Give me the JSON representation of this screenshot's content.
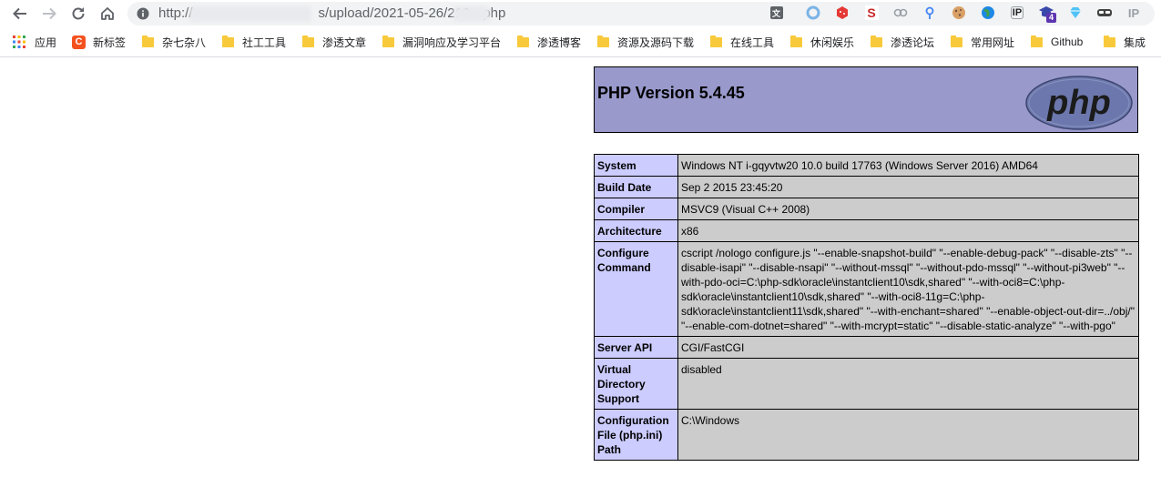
{
  "browser": {
    "url": {
      "scheme": "http://",
      "path": "s/upload/2021-05-26/210",
      "extension": "php"
    },
    "extension_icons": [
      "translate-icon",
      "circle-extension-icon",
      "red-cube-extension-icon",
      "s-badge-extension-icon",
      "link-extension-icon",
      "pin-extension-icon",
      "cookie-extension-icon",
      "globe-extension-icon",
      "ip-extension-icon",
      "graduation-cap-extension-icon",
      "diamond-extension-icon",
      "mask-extension-icon",
      "ip-text-extension-icon"
    ],
    "extension_badge": "4",
    "ip_label_1": "IP",
    "ip_label_2": "IP",
    "s_badge": "S",
    "bookmarks": [
      {
        "label": "应用",
        "kind": "apps"
      },
      {
        "label": "新标签",
        "kind": "c"
      },
      {
        "label": "杂七杂八",
        "kind": "folder"
      },
      {
        "label": "社工工具",
        "kind": "folder"
      },
      {
        "label": "渗透文章",
        "kind": "folder"
      },
      {
        "label": "漏洞响应及学习平台",
        "kind": "folder"
      },
      {
        "label": "渗透博客",
        "kind": "folder"
      },
      {
        "label": "资源及源码下载",
        "kind": "folder"
      },
      {
        "label": "在线工具",
        "kind": "folder"
      },
      {
        "label": "休闲娱乐",
        "kind": "folder"
      },
      {
        "label": "渗透论坛",
        "kind": "folder"
      },
      {
        "label": "常用网址",
        "kind": "folder"
      },
      {
        "label": "Github",
        "kind": "folder"
      },
      {
        "label": "集成",
        "kind": "folder"
      }
    ],
    "c_icon_letter": "C"
  },
  "phpinfo": {
    "title": "PHP Version 5.4.45",
    "logo_text": "php",
    "rows": [
      {
        "key": "System",
        "value": "Windows NT i-gqyvtw20 10.0 build 17763 (Windows Server 2016) AMD64"
      },
      {
        "key": "Build Date",
        "value": "Sep 2 2015 23:45:20"
      },
      {
        "key": "Compiler",
        "value": "MSVC9 (Visual C++ 2008)"
      },
      {
        "key": "Architecture",
        "value": "x86"
      },
      {
        "key": "Configure Command",
        "value": "cscript /nologo configure.js \"--enable-snapshot-build\" \"--enable-debug-pack\" \"--disable-zts\" \"--disable-isapi\" \"--disable-nsapi\" \"--without-mssql\" \"--without-pdo-mssql\" \"--without-pi3web\" \"--with-pdo-oci=C:\\php-sdk\\oracle\\instantclient10\\sdk,shared\" \"--with-oci8=C:\\php-sdk\\oracle\\instantclient10\\sdk,shared\" \"--with-oci8-11g=C:\\php-sdk\\oracle\\instantclient11\\sdk,shared\" \"--with-enchant=shared\" \"--enable-object-out-dir=../obj/\" \"--enable-com-dotnet=shared\" \"--with-mcrypt=static\" \"--disable-static-analyze\" \"--with-pgo\""
      },
      {
        "key": "Server API",
        "value": "CGI/FastCGI"
      },
      {
        "key": "Virtual Directory Support",
        "value": "disabled"
      },
      {
        "key": "Configuration File (php.ini) Path",
        "value": "C:\\Windows"
      }
    ]
  }
}
